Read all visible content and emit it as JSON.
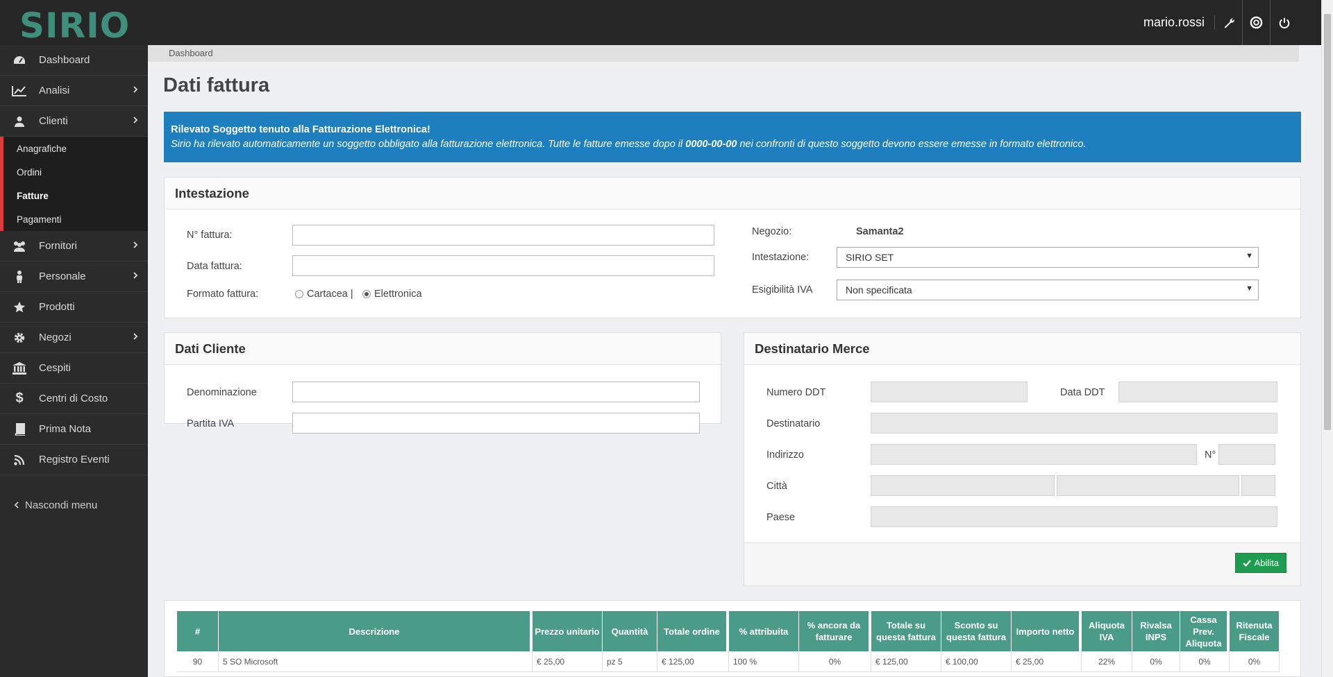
{
  "app": {
    "logo": "SIRIO"
  },
  "header": {
    "username": "mario.rossi",
    "icons": [
      "wrench-icon",
      "support-icon",
      "power-icon"
    ]
  },
  "sidebar": {
    "items": [
      {
        "label": "Dashboard",
        "icon": "dashboard-icon"
      },
      {
        "label": "Analisi",
        "icon": "chart-icon"
      },
      {
        "label": "Clienti",
        "icon": "user-icon"
      },
      {
        "label": "Fornitori",
        "icon": "users-icon"
      },
      {
        "label": "Personale",
        "icon": "person-icon"
      },
      {
        "label": "Prodotti",
        "icon": "star-icon"
      },
      {
        "label": "Negozi",
        "icon": "gear-icon"
      },
      {
        "label": "Cespiti",
        "icon": "bank-icon"
      },
      {
        "label": "Centri di Costo",
        "icon": "dollar-icon"
      },
      {
        "label": "Prima Nota",
        "icon": "book-icon"
      },
      {
        "label": "Registro Eventi",
        "icon": "rss-icon"
      }
    ],
    "clienti_sub": [
      "Anagrafiche",
      "Ordini",
      "Fatture",
      "Pagamenti"
    ],
    "hide_menu": "Nascondi menu"
  },
  "breadcrumb": "Dashboard",
  "page_title": "Dati fattura",
  "alert": {
    "title": "Rilevato Soggetto tenuto alla Fatturazione Elettronica!",
    "text_before": "Sirio ha rilevato automaticamente un soggetto obbligato alla fatturazione elettronica. Tutte le fatture emesse dopo il ",
    "date": "0000-00-00",
    "text_after": " nei confronti di questo soggetto devono essere emesse in formato elettronico."
  },
  "intestazione": {
    "heading": "Intestazione",
    "n_fattura_label": "N° fattura:",
    "data_fattura_label": "Data fattura:",
    "formato_label": "Formato fattura:",
    "formato_cartacea": "Cartacea |",
    "formato_elettronica": "Elettronica",
    "negozio_label": "Negozio:",
    "negozio_value": "Samanta2",
    "intestazione_label": "Intestazione:",
    "intestazione_value": "SIRIO SET",
    "esigibilita_label": "Esigibilità IVA",
    "esigibilita_value": "Non specificata"
  },
  "dati_cliente": {
    "heading": "Dati Cliente",
    "denominazione_label": "Denominazione",
    "partita_iva_label": "Partita IVA"
  },
  "destinatario": {
    "heading": "Destinatario Merce",
    "numero_ddt_label": "Numero DDT",
    "data_ddt_label": "Data DDT",
    "destinatario_label": "Destinatario",
    "indirizzo_label": "Indirizzo",
    "numero_label": "N°",
    "citta_label": "Città",
    "paese_label": "Paese",
    "abilita_button": "Abilita"
  },
  "table": {
    "headers": [
      "#",
      "Descrizione",
      "Prezzo unitario",
      "Quantità",
      "Totale ordine",
      "% attribuita",
      "% ancora da fatturare",
      "Totale su questa fattura",
      "Sconto su questa fattura",
      "Importo netto",
      "Aliquota IVA",
      "Rivalsa INPS",
      "Cassa Prev. Aliquota",
      "Ritenuta Fiscale"
    ],
    "row": [
      "90",
      "5 SO Microsoft",
      "€ 25,00",
      "pz 5",
      "€ 125,00",
      "100 %",
      "0%",
      "€ 125,00",
      "€ 100,00",
      "€ 25,00",
      "22%",
      "0%",
      "0%",
      "0%"
    ]
  }
}
